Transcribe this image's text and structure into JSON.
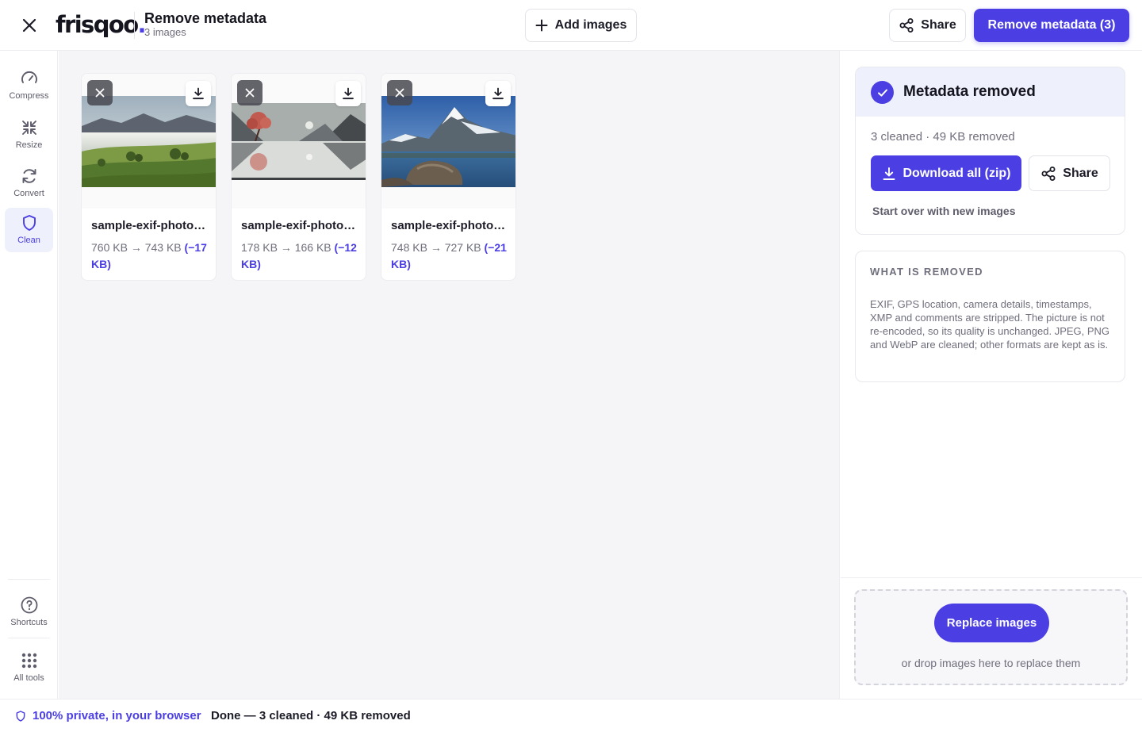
{
  "colors": {
    "accent": "#4b3fe3",
    "accent_soft": "#eef0fb",
    "text": "#1c1c28",
    "muted": "#6f6f7d"
  },
  "header": {
    "logo": "frisqoo",
    "logo_dot": ".",
    "title": "Remove metadata",
    "subtitle": "3 images",
    "add_images_label": "Add images",
    "share_label": "Share",
    "primary_label": "Remove metadata (3)"
  },
  "rail": {
    "items": [
      {
        "label": "Compress",
        "icon": "gauge-icon"
      },
      {
        "label": "Resize",
        "icon": "resize-icon"
      },
      {
        "label": "Convert",
        "icon": "refresh-icon"
      },
      {
        "label": "Clean",
        "icon": "shield-icon",
        "active": true
      }
    ],
    "bottom": [
      {
        "label": "Shortcuts",
        "icon": "help-circle-icon"
      },
      {
        "label": "All tools",
        "icon": "grid-icon"
      }
    ]
  },
  "images": [
    {
      "name": "sample-exif-photo…",
      "before": "760 KB",
      "arrow": "→",
      "after": "743 KB",
      "saved": "(−17 KB)"
    },
    {
      "name": "sample-exif-photo…",
      "before": "178 KB",
      "arrow": "→",
      "after": "166 KB",
      "saved": "(−12 KB)"
    },
    {
      "name": "sample-exif-photo…",
      "before": "748 KB",
      "arrow": "→",
      "after": "727 KB",
      "saved": "(−21 KB)"
    }
  ],
  "panel": {
    "status_title": "Metadata removed",
    "status_meta": "3 cleaned · 49 KB removed",
    "download_label": "Download all (zip)",
    "share_label": "Share",
    "start_over": "Start over with new images",
    "info_title": "WHAT IS REMOVED",
    "info_body": "EXIF, GPS location, camera details, timestamps, XMP and comments are stripped. The picture is not re-encoded, so its quality is unchanged. JPEG, PNG and WebP are cleaned; other formats are kept as is.",
    "replace_label": "Replace images",
    "drop_hint": "or drop images here to replace them"
  },
  "footer": {
    "privacy": "100% private, in your browser",
    "status": "Done — 3 cleaned · 49 KB removed"
  }
}
